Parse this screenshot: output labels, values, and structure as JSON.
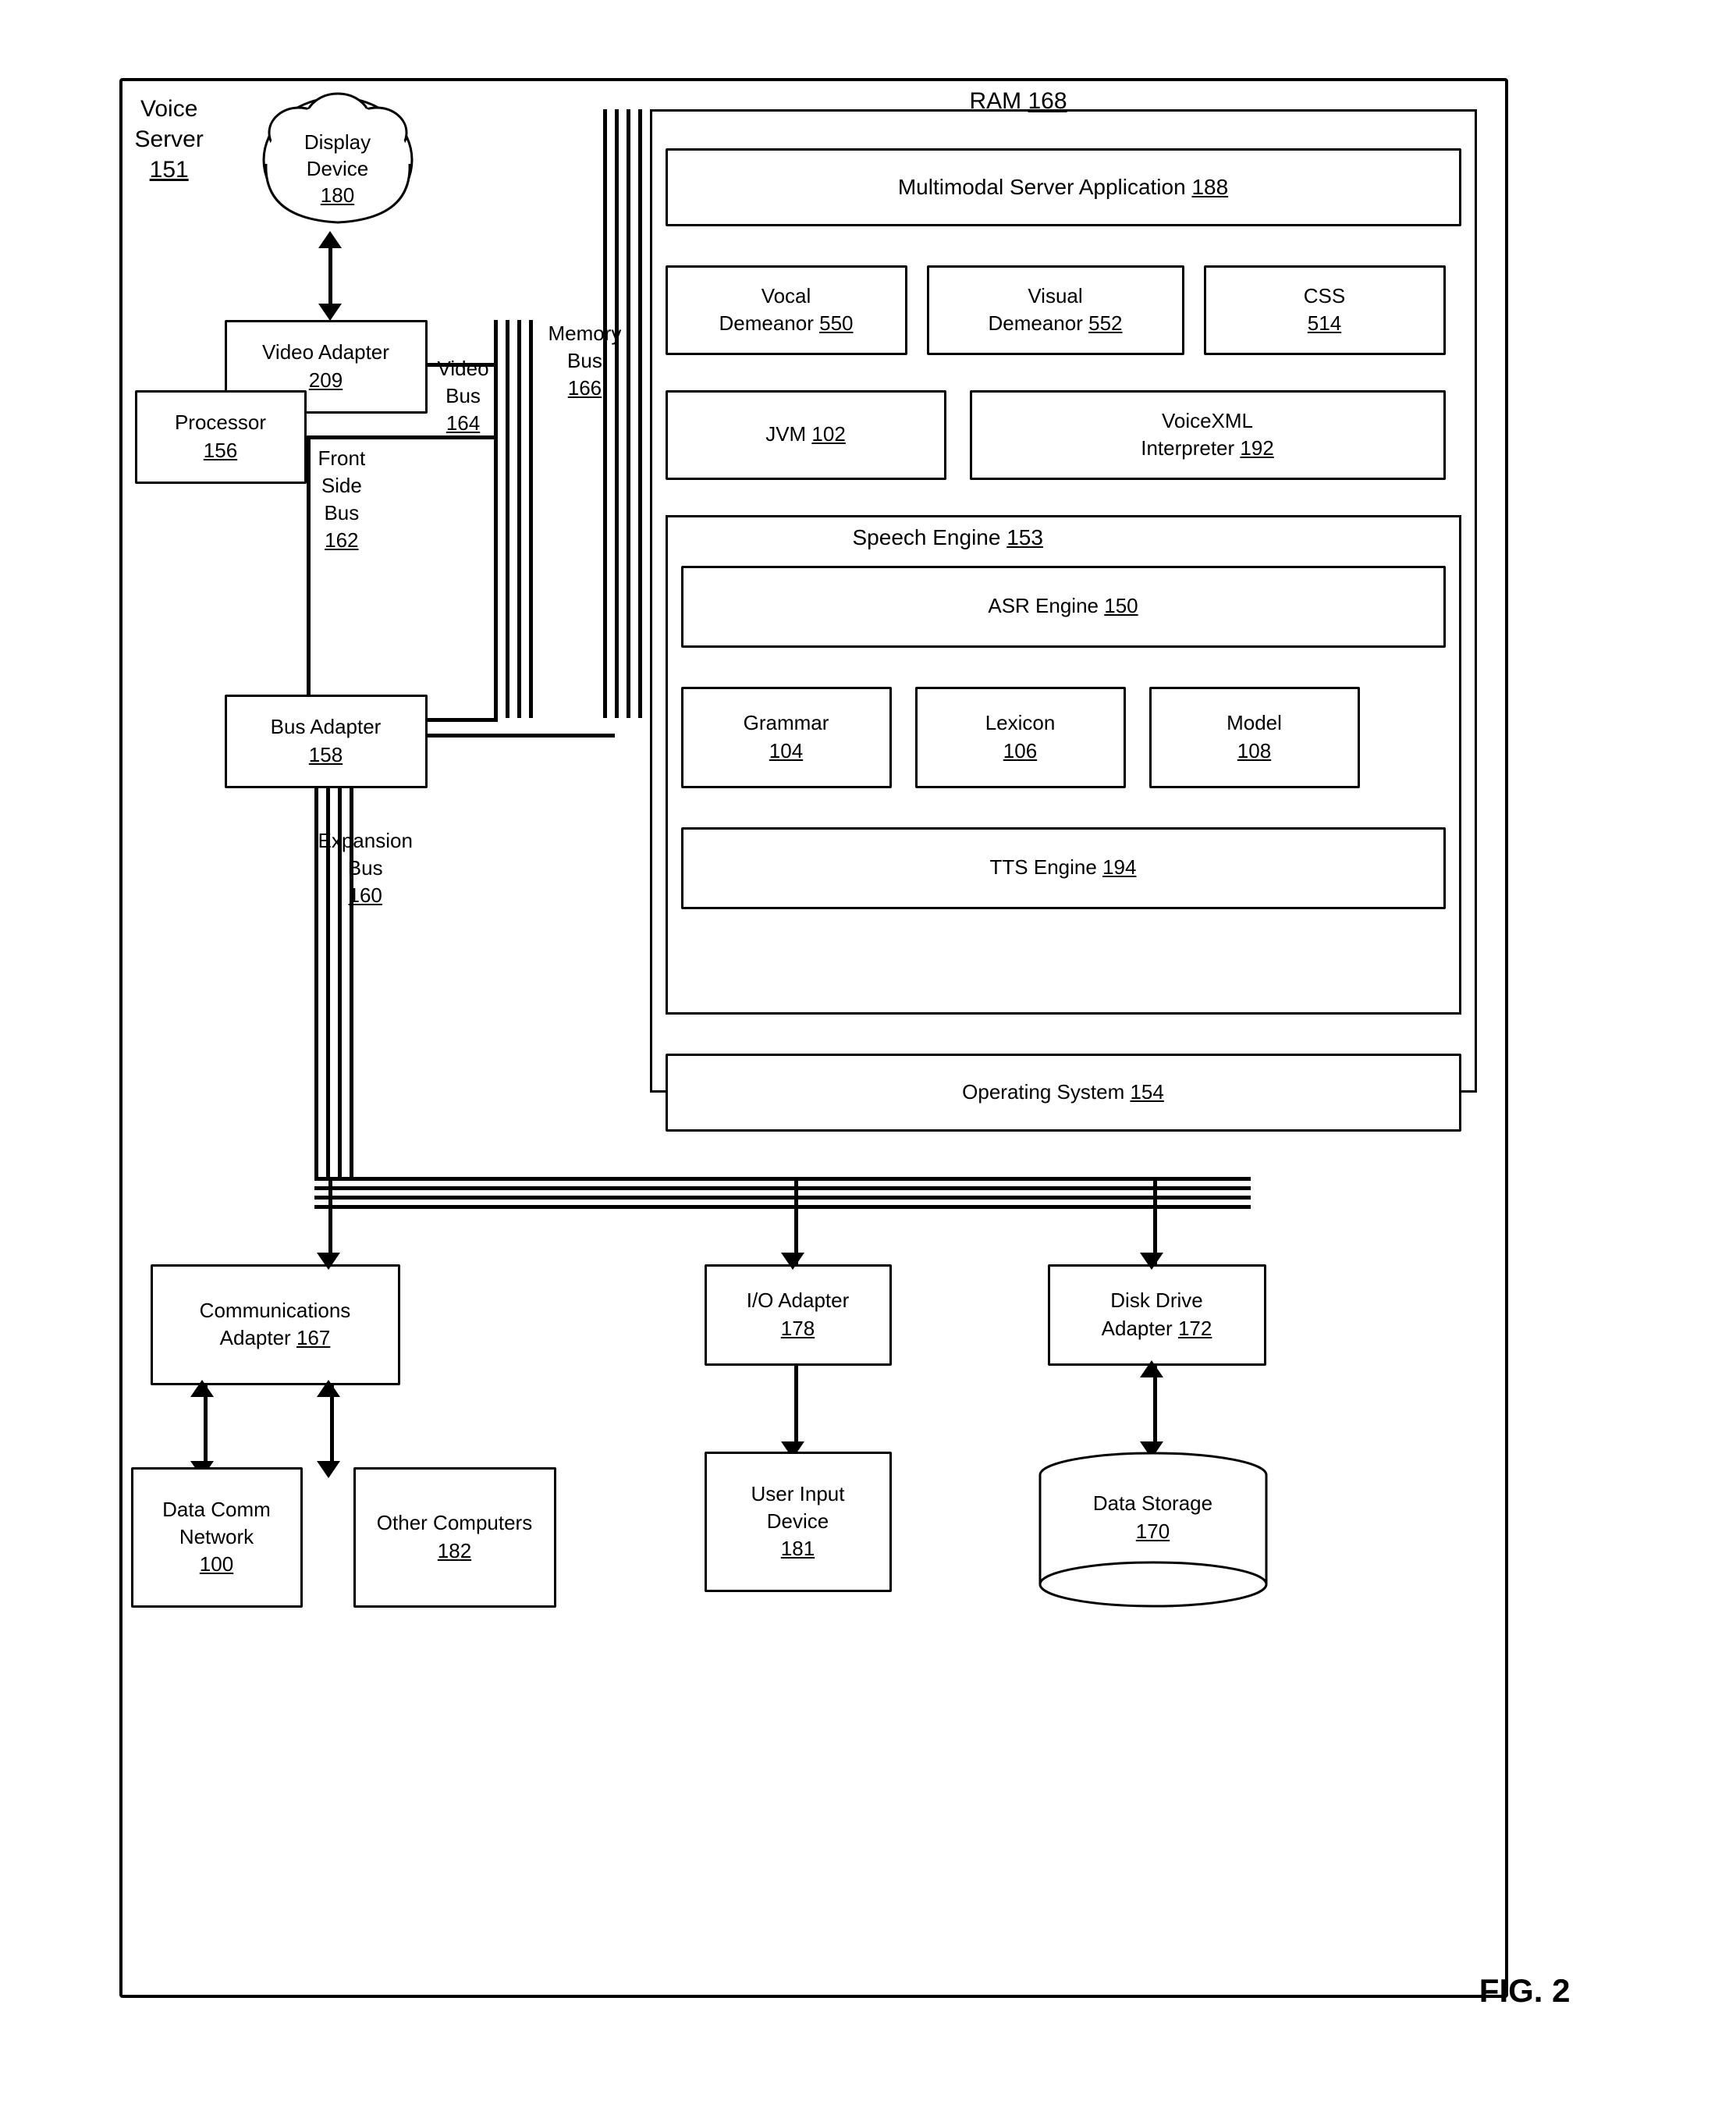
{
  "diagram": {
    "title": "FIG. 2",
    "voiceServer": {
      "label": "Voice\nServer",
      "number": "151"
    },
    "displayDevice": {
      "label": "Display\nDevice",
      "number": "180"
    },
    "ram": {
      "label": "RAM",
      "number": "168"
    },
    "multimodalApp": {
      "label": "Multimodal Server Application",
      "number": "188"
    },
    "vocalDemeanor": {
      "label": "Vocal\nDemeanor",
      "number": "550"
    },
    "visualDemeanor": {
      "label": "Visual\nDemeanor",
      "number": "552"
    },
    "css": {
      "label": "CSS",
      "number": "514"
    },
    "jvm": {
      "label": "JVM",
      "number": "102"
    },
    "voiceXML": {
      "label": "VoiceXML\nInterpreter",
      "number": "192"
    },
    "speechEngine": {
      "label": "Speech Engine",
      "number": "153"
    },
    "asrEngine": {
      "label": "ASR Engine",
      "number": "150"
    },
    "grammar": {
      "label": "Grammar",
      "number": "104"
    },
    "lexicon": {
      "label": "Lexicon",
      "number": "106"
    },
    "model": {
      "label": "Model",
      "number": "108"
    },
    "ttsEngine": {
      "label": "TTS Engine",
      "number": "194"
    },
    "operatingSystem": {
      "label": "Operating System",
      "number": "154"
    },
    "processor": {
      "label": "Processor",
      "number": "156"
    },
    "videoAdapter": {
      "label": "Video Adapter",
      "number": "209"
    },
    "busAdapter": {
      "label": "Bus Adapter",
      "number": "158"
    },
    "videoBus": {
      "label": "Video\nBus",
      "number": "164"
    },
    "memoryBus": {
      "label": "Memory\nBus",
      "number": "166"
    },
    "frontSideBus": {
      "label": "Front\nSide\nBus",
      "number": "162"
    },
    "expansionBus": {
      "label": "Expansion\nBus",
      "number": "160"
    },
    "commsAdapter": {
      "label": "Communications\nAdapter",
      "number": "167"
    },
    "ioAdapter": {
      "label": "I/O Adapter",
      "number": "178"
    },
    "diskDriveAdapter": {
      "label": "Disk Drive\nAdapter",
      "number": "172"
    },
    "dataCommNetwork": {
      "label": "Data Comm\nNetwork",
      "number": "100"
    },
    "otherComputers": {
      "label": "Other Computers",
      "number": "182"
    },
    "userInputDevice": {
      "label": "User Input\nDevice",
      "number": "181"
    },
    "dataStorage": {
      "label": "Data Storage",
      "number": "170"
    }
  }
}
